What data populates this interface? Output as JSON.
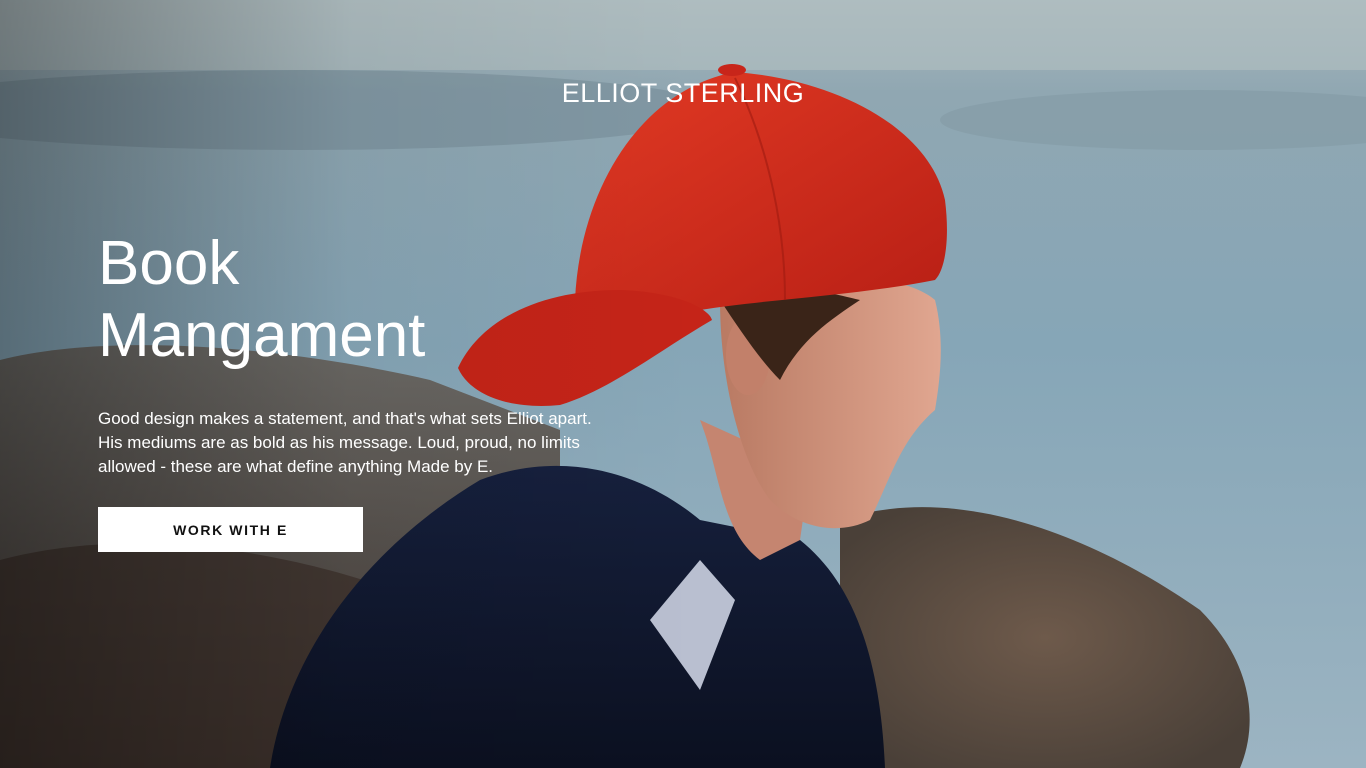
{
  "header": {
    "site_title": "ELLIOT STERLING"
  },
  "hero": {
    "headline_line1": "Book",
    "headline_line2": "Mangament",
    "description": "Good design makes a statement, and that's what sets Elliot apart. His mediums are as bold as his message. Loud, proud, no limits allowed - these are what define anything Made by E.",
    "cta_label": "WORK WITH E"
  },
  "colors": {
    "text": "#ffffff",
    "button_bg": "#ffffff",
    "button_text": "#111111",
    "cap_red": "#d62a1c",
    "jacket_navy": "#121a33",
    "water": "#8aa9b8"
  }
}
